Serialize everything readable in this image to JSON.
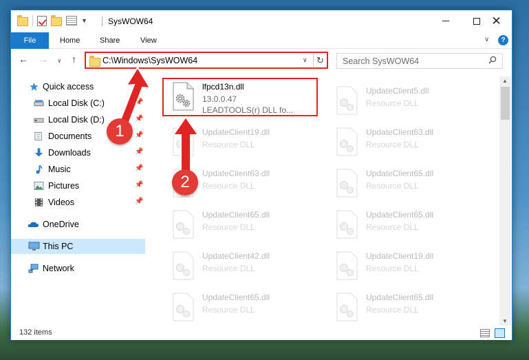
{
  "window": {
    "title": "SysWOW64",
    "close_glyph": "✕"
  },
  "ribbon": {
    "tabs": [
      {
        "label": "File"
      },
      {
        "label": "Home"
      },
      {
        "label": "Share"
      },
      {
        "label": "View"
      }
    ],
    "help": "?"
  },
  "address": {
    "path": "C:\\Windows\\SysWOW64"
  },
  "search": {
    "placeholder": "Search SysWOW64"
  },
  "sidebar": {
    "items": [
      {
        "label": "Quick access",
        "icon": "star-icon"
      },
      {
        "label": "Local Disk (C:)",
        "icon": "drive-icon",
        "pinned": true
      },
      {
        "label": "Local Disk (D:)",
        "icon": "drive-icon",
        "pinned": true
      },
      {
        "label": "Documents",
        "icon": "documents-icon",
        "pinned": true
      },
      {
        "label": "Downloads",
        "icon": "downloads-icon",
        "pinned": true
      },
      {
        "label": "Music",
        "icon": "music-icon",
        "pinned": true
      },
      {
        "label": "Pictures",
        "icon": "pictures-icon",
        "pinned": true
      },
      {
        "label": "Videos",
        "icon": "videos-icon",
        "pinned": true
      },
      {
        "label": "OneDrive",
        "icon": "onedrive-icon"
      },
      {
        "label": "This PC",
        "icon": "computer-icon",
        "selected": true
      },
      {
        "label": "Network",
        "icon": "network-icon"
      }
    ]
  },
  "files": {
    "highlighted": {
      "name": "lfpcd13n.dll",
      "version": "13.0.0.47",
      "description": "LEADTOOLS(r) DLL fo..."
    },
    "others": [
      {
        "name": "UpdateClient5.dll",
        "type": "Resource DLL"
      },
      {
        "name": "UpdateClient19.dll",
        "type": "Resource DLL"
      },
      {
        "name": "UpdateClient63.dll",
        "type": "Resource DLL"
      },
      {
        "name": "UpdateClient63.dll",
        "type": "Resource DLL"
      },
      {
        "name": "UpdateClient65.dll",
        "type": "Resource DLL"
      },
      {
        "name": "UpdateClient65.dll",
        "type": "Resource DLL"
      },
      {
        "name": "UpdateClient65.dll",
        "type": "Resource DLL"
      },
      {
        "name": "UpdateClient42.dll",
        "type": "Resource DLL"
      },
      {
        "name": "UpdateClient19.dll",
        "type": "Resource DLL"
      },
      {
        "name": "UpdateClient65.dll",
        "type": "Resource DLL"
      },
      {
        "name": "UpdateClient65.dll",
        "type": "Resource DLL"
      }
    ]
  },
  "status": {
    "item_count": "132 items"
  },
  "annotations": {
    "step1": "1",
    "step2": "2",
    "color": "#e02424"
  }
}
